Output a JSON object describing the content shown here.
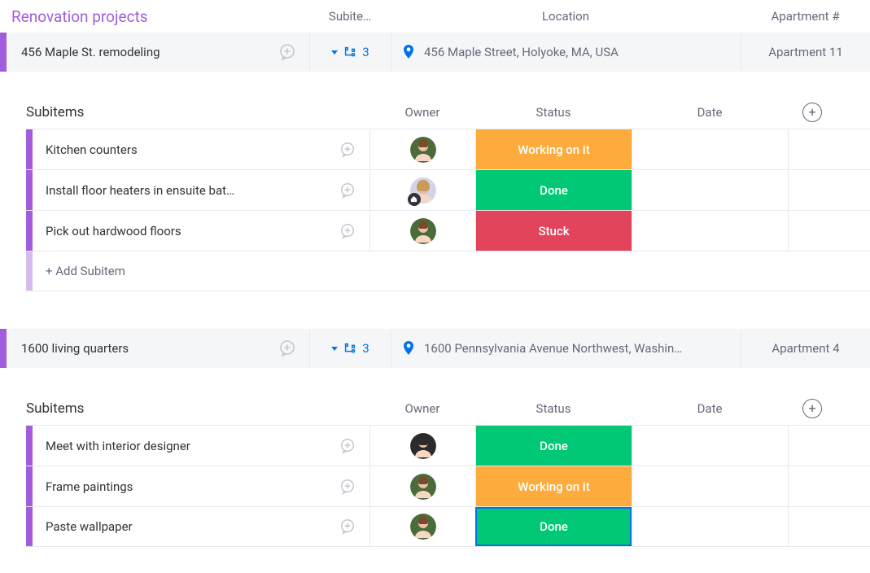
{
  "group": {
    "title": "Renovation projects"
  },
  "columns": {
    "subitems": "Subite…",
    "location": "Location",
    "apartment": "Apartment #"
  },
  "projects": [
    {
      "name": "456 Maple St. remodeling",
      "subitem_count": "3",
      "location": "456 Maple Street, Holyoke, MA, USA",
      "apartment": "Apartment 11",
      "sub_header": {
        "label": "Subitems",
        "owner": "Owner",
        "status": "Status",
        "date": "Date"
      },
      "subitems": [
        {
          "name": "Kitchen counters",
          "owner_avatar": "avatar-1",
          "status": "Working on it",
          "status_color": "#fdab3d"
        },
        {
          "name": "Install floor heaters in ensuite bat…",
          "owner_avatar": "avatar-2",
          "home_badge": true,
          "status": "Done",
          "status_color": "#00c875"
        },
        {
          "name": "Pick out hardwood floors",
          "owner_avatar": "avatar-1",
          "status": "Stuck",
          "status_color": "#e2445c"
        }
      ],
      "add_subitem_label": "+ Add Subitem"
    },
    {
      "name": "1600 living quarters",
      "subitem_count": "3",
      "location": "1600 Pennsylvania Avenue Northwest, Washin…",
      "apartment": "Apartment 4",
      "sub_header": {
        "label": "Subitems",
        "owner": "Owner",
        "status": "Status",
        "date": "Date"
      },
      "subitems": [
        {
          "name": "Meet with interior designer",
          "owner_avatar": "avatar-3",
          "status": "Done",
          "status_color": "#00c875"
        },
        {
          "name": "Frame paintings",
          "owner_avatar": "avatar-1",
          "status": "Working on it",
          "status_color": "#fdab3d"
        },
        {
          "name": "Paste wallpaper",
          "owner_avatar": "avatar-1",
          "status": "Done",
          "status_color": "#00c875",
          "selected": true
        }
      ]
    }
  ],
  "avatars": {
    "avatar-1": {
      "bg": "#4a6b3a",
      "ring": "#4a6b3a"
    },
    "avatar-2": {
      "bg": "#e8c9a0",
      "ring": "#d0d4e4"
    },
    "avatar-3": {
      "bg": "#3a3a3a",
      "ring": "#3a3a3a"
    }
  }
}
